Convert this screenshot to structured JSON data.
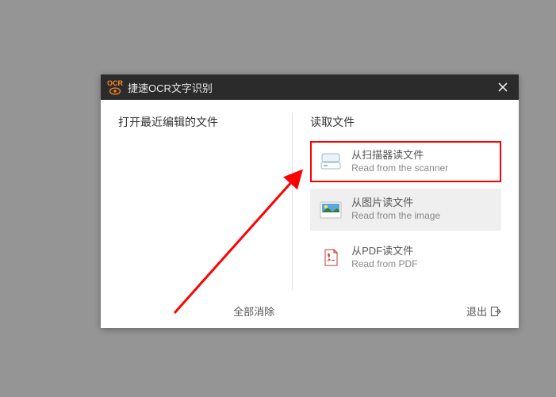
{
  "titlebar": {
    "logo_text": "OCR",
    "title": "捷速OCR文字识别"
  },
  "left": {
    "heading": "打开最近编辑的文件",
    "clear_all": "全部消除"
  },
  "right": {
    "heading": "读取文件",
    "options": [
      {
        "zh": "从扫描器读文件",
        "en": "Read from the scanner"
      },
      {
        "zh": "从图片读文件",
        "en": "Read from the image"
      },
      {
        "zh": "从PDF读文件",
        "en": "Read from PDF"
      }
    ],
    "exit": "退出"
  }
}
